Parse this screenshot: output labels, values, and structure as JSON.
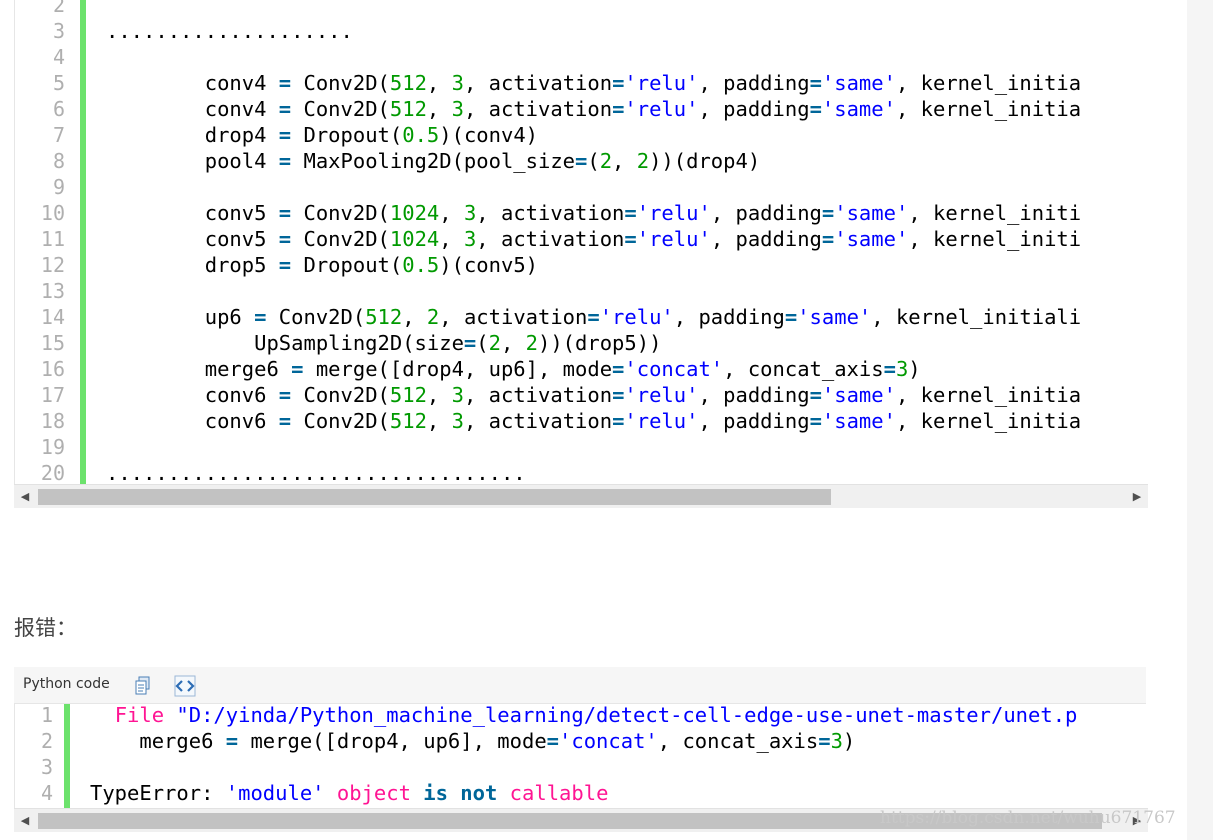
{
  "block1": {
    "line_numbers": [
      "2",
      "3",
      "4",
      "5",
      "6",
      "7",
      "8",
      "9",
      "10",
      "11",
      "12",
      "13",
      "14",
      "15",
      "16",
      "17",
      "18",
      "19",
      "20"
    ],
    "lines": [
      [],
      [
        {
          "t": "....................",
          "c": ""
        }
      ],
      [],
      [
        {
          "t": "        conv4 ",
          "c": ""
        },
        {
          "t": "=",
          "c": "op"
        },
        {
          "t": " Conv2D(",
          "c": ""
        },
        {
          "t": "512",
          "c": "num"
        },
        {
          "t": ", ",
          "c": ""
        },
        {
          "t": "3",
          "c": "num"
        },
        {
          "t": ", activation",
          "c": ""
        },
        {
          "t": "=",
          "c": "op"
        },
        {
          "t": "'relu'",
          "c": "str"
        },
        {
          "t": ", padding",
          "c": ""
        },
        {
          "t": "=",
          "c": "op"
        },
        {
          "t": "'same'",
          "c": "str"
        },
        {
          "t": ", kernel_initia",
          "c": ""
        }
      ],
      [
        {
          "t": "        conv4 ",
          "c": ""
        },
        {
          "t": "=",
          "c": "op"
        },
        {
          "t": " Conv2D(",
          "c": ""
        },
        {
          "t": "512",
          "c": "num"
        },
        {
          "t": ", ",
          "c": ""
        },
        {
          "t": "3",
          "c": "num"
        },
        {
          "t": ", activation",
          "c": ""
        },
        {
          "t": "=",
          "c": "op"
        },
        {
          "t": "'relu'",
          "c": "str"
        },
        {
          "t": ", padding",
          "c": ""
        },
        {
          "t": "=",
          "c": "op"
        },
        {
          "t": "'same'",
          "c": "str"
        },
        {
          "t": ", kernel_initia",
          "c": ""
        }
      ],
      [
        {
          "t": "        drop4 ",
          "c": ""
        },
        {
          "t": "=",
          "c": "op"
        },
        {
          "t": " Dropout(",
          "c": ""
        },
        {
          "t": "0.5",
          "c": "num"
        },
        {
          "t": ")(conv4)",
          "c": ""
        }
      ],
      [
        {
          "t": "        pool4 ",
          "c": ""
        },
        {
          "t": "=",
          "c": "op"
        },
        {
          "t": " MaxPooling2D(pool_size",
          "c": ""
        },
        {
          "t": "=",
          "c": "op"
        },
        {
          "t": "(",
          "c": ""
        },
        {
          "t": "2",
          "c": "num"
        },
        {
          "t": ", ",
          "c": ""
        },
        {
          "t": "2",
          "c": "num"
        },
        {
          "t": "))(drop4)",
          "c": ""
        }
      ],
      [],
      [
        {
          "t": "        conv5 ",
          "c": ""
        },
        {
          "t": "=",
          "c": "op"
        },
        {
          "t": " Conv2D(",
          "c": ""
        },
        {
          "t": "1024",
          "c": "num"
        },
        {
          "t": ", ",
          "c": ""
        },
        {
          "t": "3",
          "c": "num"
        },
        {
          "t": ", activation",
          "c": ""
        },
        {
          "t": "=",
          "c": "op"
        },
        {
          "t": "'relu'",
          "c": "str"
        },
        {
          "t": ", padding",
          "c": ""
        },
        {
          "t": "=",
          "c": "op"
        },
        {
          "t": "'same'",
          "c": "str"
        },
        {
          "t": ", kernel_initi",
          "c": ""
        }
      ],
      [
        {
          "t": "        conv5 ",
          "c": ""
        },
        {
          "t": "=",
          "c": "op"
        },
        {
          "t": " Conv2D(",
          "c": ""
        },
        {
          "t": "1024",
          "c": "num"
        },
        {
          "t": ", ",
          "c": ""
        },
        {
          "t": "3",
          "c": "num"
        },
        {
          "t": ", activation",
          "c": ""
        },
        {
          "t": "=",
          "c": "op"
        },
        {
          "t": "'relu'",
          "c": "str"
        },
        {
          "t": ", padding",
          "c": ""
        },
        {
          "t": "=",
          "c": "op"
        },
        {
          "t": "'same'",
          "c": "str"
        },
        {
          "t": ", kernel_initi",
          "c": ""
        }
      ],
      [
        {
          "t": "        drop5 ",
          "c": ""
        },
        {
          "t": "=",
          "c": "op"
        },
        {
          "t": " Dropout(",
          "c": ""
        },
        {
          "t": "0.5",
          "c": "num"
        },
        {
          "t": ")(conv5)",
          "c": ""
        }
      ],
      [],
      [
        {
          "t": "        up6 ",
          "c": ""
        },
        {
          "t": "=",
          "c": "op"
        },
        {
          "t": " Conv2D(",
          "c": ""
        },
        {
          "t": "512",
          "c": "num"
        },
        {
          "t": ", ",
          "c": ""
        },
        {
          "t": "2",
          "c": "num"
        },
        {
          "t": ", activation",
          "c": ""
        },
        {
          "t": "=",
          "c": "op"
        },
        {
          "t": "'relu'",
          "c": "str"
        },
        {
          "t": ", padding",
          "c": ""
        },
        {
          "t": "=",
          "c": "op"
        },
        {
          "t": "'same'",
          "c": "str"
        },
        {
          "t": ", kernel_initiali",
          "c": ""
        }
      ],
      [
        {
          "t": "            UpSampling2D(size",
          "c": ""
        },
        {
          "t": "=",
          "c": "op"
        },
        {
          "t": "(",
          "c": ""
        },
        {
          "t": "2",
          "c": "num"
        },
        {
          "t": ", ",
          "c": ""
        },
        {
          "t": "2",
          "c": "num"
        },
        {
          "t": "))(drop5))",
          "c": ""
        }
      ],
      [
        {
          "t": "        merge6 ",
          "c": ""
        },
        {
          "t": "=",
          "c": "op"
        },
        {
          "t": " merge([drop4, up6], mode",
          "c": ""
        },
        {
          "t": "=",
          "c": "op"
        },
        {
          "t": "'concat'",
          "c": "str"
        },
        {
          "t": ", concat_axis",
          "c": ""
        },
        {
          "t": "=",
          "c": "op"
        },
        {
          "t": "3",
          "c": "num"
        },
        {
          "t": ")",
          "c": ""
        }
      ],
      [
        {
          "t": "        conv6 ",
          "c": ""
        },
        {
          "t": "=",
          "c": "op"
        },
        {
          "t": " Conv2D(",
          "c": ""
        },
        {
          "t": "512",
          "c": "num"
        },
        {
          "t": ", ",
          "c": ""
        },
        {
          "t": "3",
          "c": "num"
        },
        {
          "t": ", activation",
          "c": ""
        },
        {
          "t": "=",
          "c": "op"
        },
        {
          "t": "'relu'",
          "c": "str"
        },
        {
          "t": ", padding",
          "c": ""
        },
        {
          "t": "=",
          "c": "op"
        },
        {
          "t": "'same'",
          "c": "str"
        },
        {
          "t": ", kernel_initia",
          "c": ""
        }
      ],
      [
        {
          "t": "        conv6 ",
          "c": ""
        },
        {
          "t": "=",
          "c": "op"
        },
        {
          "t": " Conv2D(",
          "c": ""
        },
        {
          "t": "512",
          "c": "num"
        },
        {
          "t": ", ",
          "c": ""
        },
        {
          "t": "3",
          "c": "num"
        },
        {
          "t": ", activation",
          "c": ""
        },
        {
          "t": "=",
          "c": "op"
        },
        {
          "t": "'relu'",
          "c": "str"
        },
        {
          "t": ", padding",
          "c": ""
        },
        {
          "t": "=",
          "c": "op"
        },
        {
          "t": "'same'",
          "c": "str"
        },
        {
          "t": ", kernel_initia",
          "c": ""
        }
      ],
      [],
      [
        {
          "t": "..................................",
          "c": ""
        }
      ]
    ],
    "scrollbar": {
      "thumb_fraction": 0.73,
      "scroll_position": 0
    }
  },
  "error_label": "报错：",
  "block2": {
    "title": "Python code",
    "toolbar_icons": [
      "copy-icon",
      "view-source-icon"
    ],
    "line_numbers": [
      "1",
      "2",
      "3",
      "4"
    ],
    "lines": [
      [
        {
          "t": "  ",
          "c": ""
        },
        {
          "t": "File",
          "c": "pink"
        },
        {
          "t": " ",
          "c": ""
        },
        {
          "t": "\"D:/yinda/Python_machine_learning/detect-cell-edge-use-unet-master/unet.p",
          "c": "str"
        }
      ],
      [
        {
          "t": "    merge6 ",
          "c": ""
        },
        {
          "t": "=",
          "c": "op"
        },
        {
          "t": " merge([drop4, up6], mode",
          "c": ""
        },
        {
          "t": "=",
          "c": "op"
        },
        {
          "t": "'concat'",
          "c": "str"
        },
        {
          "t": ", concat_axis",
          "c": ""
        },
        {
          "t": "=",
          "c": "op"
        },
        {
          "t": "3",
          "c": "num"
        },
        {
          "t": ")",
          "c": ""
        }
      ],
      [],
      [
        {
          "t": "TypeError: ",
          "c": ""
        },
        {
          "t": "'module'",
          "c": "str"
        },
        {
          "t": " ",
          "c": ""
        },
        {
          "t": "object",
          "c": "pink"
        },
        {
          "t": " ",
          "c": ""
        },
        {
          "t": "is",
          "c": "kw"
        },
        {
          "t": " ",
          "c": ""
        },
        {
          "t": "not",
          "c": "kw"
        },
        {
          "t": " ",
          "c": ""
        },
        {
          "t": "callable",
          "c": "pink"
        }
      ]
    ],
    "scrollbar": {
      "thumb_fraction": 0.98,
      "scroll_position": 0
    }
  },
  "watermark": "https://blog.csdn.net/wuhu671767",
  "colors": {
    "accent_bar": "#6ce26c",
    "keyword": "#006699",
    "number": "#009900",
    "string": "#0000ff",
    "pink": "#ff1493"
  }
}
